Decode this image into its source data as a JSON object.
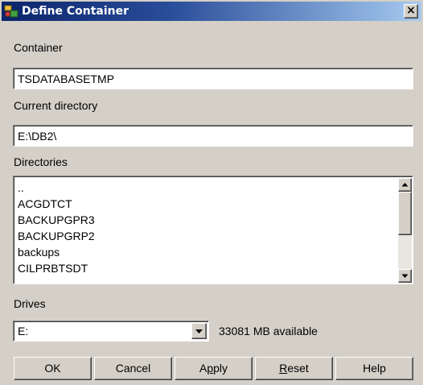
{
  "window": {
    "title": "Define Container",
    "close_glyph": "×",
    "icon": "container-icon"
  },
  "container": {
    "label": "Container",
    "value": "TSDATABASETMP"
  },
  "current_directory": {
    "label": "Current directory",
    "value": "E:\\DB2\\"
  },
  "directories": {
    "label": "Directories",
    "items": [
      "..",
      "ACGDTCT",
      "BACKUPGPR3",
      "BACKUPGRP2",
      "backups",
      "CILPRBTSDT"
    ]
  },
  "drives": {
    "label": "Drives",
    "selected": "E:",
    "available_text": "33081 MB available"
  },
  "buttons": {
    "ok": "OK",
    "cancel": "Cancel",
    "apply_pre": "A",
    "apply_mnemonic": "p",
    "apply_post": "ply",
    "reset_mnemonic": "R",
    "reset_post": "eset",
    "help": "Help"
  },
  "colors": {
    "title_gradient_start": "#0a246a",
    "title_gradient_end": "#a6caf0",
    "face": "#d4d0c8"
  }
}
